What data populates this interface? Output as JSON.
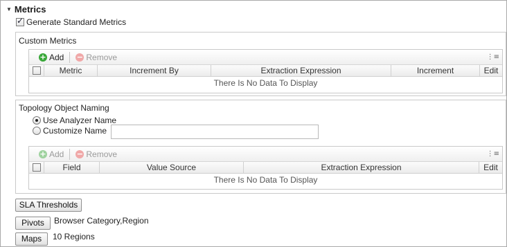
{
  "metrics": {
    "title": "Metrics",
    "generate_label": "Generate Standard Metrics",
    "generate_checked": true
  },
  "custom_metrics": {
    "title": "Custom Metrics",
    "toolbar": {
      "add": "Add",
      "remove": "Remove"
    },
    "columns": [
      "Metric",
      "Increment By",
      "Extraction Expression",
      "Increment",
      "Edit"
    ],
    "empty_text": "There Is No Data To Display"
  },
  "topology": {
    "title": "Topology Object Naming",
    "use_analyzer": "Use Analyzer Name",
    "customize": "Customize Name",
    "selected": "use_analyzer",
    "customize_value": "",
    "toolbar": {
      "add": "Add",
      "remove": "Remove"
    },
    "columns": [
      "Field",
      "Value Source",
      "Extraction Expression",
      "Edit"
    ],
    "empty_text": "There Is No Data To Display"
  },
  "buttons": {
    "sla": "SLA Thresholds",
    "pivots": "Pivots",
    "pivots_value": "Browser Category,Region",
    "maps": "Maps",
    "maps_value": "10 Regions"
  }
}
